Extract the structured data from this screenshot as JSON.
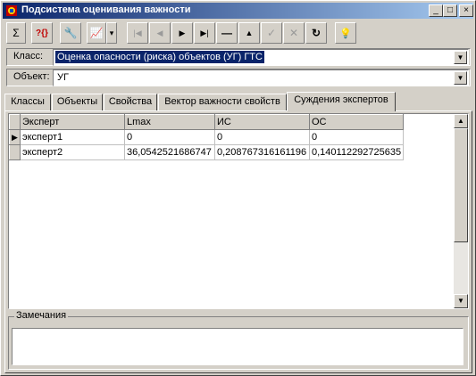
{
  "window": {
    "title": "Подсистема оценивания важности"
  },
  "title_buttons": {
    "minimize": "_",
    "maximize": "□",
    "close": "×"
  },
  "toolbar": {
    "buttons": [
      {
        "icon": "sigma-icon",
        "glyph": "Σ",
        "enabled": true
      },
      {
        "icon": "help-icon",
        "glyph": "?{}",
        "enabled": true
      },
      {
        "icon": "tools-icon",
        "glyph": "🔧",
        "enabled": true
      },
      {
        "icon": "chart-icon",
        "glyph": "📈",
        "enabled": true
      },
      {
        "icon": "chart-dropdown-icon",
        "glyph": "▾",
        "enabled": true
      },
      {
        "icon": "first-record-icon",
        "glyph": "|◀",
        "enabled": false
      },
      {
        "icon": "prior-record-icon",
        "glyph": "◀",
        "enabled": false
      },
      {
        "icon": "next-record-icon",
        "glyph": "▶",
        "enabled": true
      },
      {
        "icon": "last-record-icon",
        "glyph": "▶|",
        "enabled": true
      },
      {
        "icon": "delete-record-icon",
        "glyph": "—",
        "enabled": true
      },
      {
        "icon": "edit-record-icon",
        "glyph": "▲",
        "enabled": true
      },
      {
        "icon": "post-edit-icon",
        "glyph": "✓",
        "enabled": false
      },
      {
        "icon": "cancel-edit-icon",
        "glyph": "✕",
        "enabled": false
      },
      {
        "icon": "refresh-icon",
        "glyph": "↻",
        "enabled": true
      },
      {
        "icon": "lightbulb-icon",
        "glyph": "💡",
        "enabled": true
      }
    ]
  },
  "class_field": {
    "label": "Класс:",
    "value": "Оценка опасности (риска) объектов (УГ) ГТС"
  },
  "object_field": {
    "label": "Объект:",
    "value": "УГ"
  },
  "tabs": [
    {
      "label": "Классы",
      "active": false
    },
    {
      "label": "Объекты",
      "active": false
    },
    {
      "label": "Свойства",
      "active": false
    },
    {
      "label": "Вектор важности свойств",
      "active": false
    },
    {
      "label": "Суждения экспертов",
      "active": true
    }
  ],
  "grid": {
    "columns": [
      "Эксперт",
      "Lmax",
      "ИС",
      "ОС"
    ],
    "rows": [
      [
        "эксперт1",
        "0",
        "0",
        "0"
      ],
      [
        "эксперт2",
        "36,0542521686747",
        "0,208767316161196",
        "0,140112292725635"
      ]
    ],
    "current_row_indicator": "▶"
  },
  "notes": {
    "label": "Замечания",
    "value": ""
  },
  "scroll": {
    "up": "▲",
    "down": "▼"
  },
  "colors": {
    "title_start": "#0a246a",
    "title_end": "#a6caf0",
    "face": "#d4d0c8",
    "selection": "#0a246a"
  }
}
